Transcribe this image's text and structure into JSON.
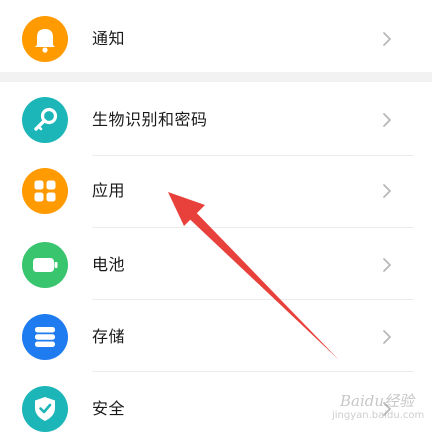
{
  "settings": {
    "items": [
      {
        "id": "notification",
        "label": "通知",
        "icon": "bell-icon",
        "color": "#FF9A00"
      },
      {
        "id": "biometrics",
        "label": "生物识别和密码",
        "icon": "key-icon",
        "color": "#1CB5B8"
      },
      {
        "id": "apps",
        "label": "应用",
        "icon": "grid-icon",
        "color": "#FF9A00"
      },
      {
        "id": "battery",
        "label": "电池",
        "icon": "battery-icon",
        "color": "#39C46E"
      },
      {
        "id": "storage",
        "label": "存储",
        "icon": "storage-icon",
        "color": "#1E7BF0"
      },
      {
        "id": "security",
        "label": "安全",
        "icon": "shield-icon",
        "color": "#1CB5B8"
      }
    ]
  },
  "annotation": {
    "color": "#E8403A"
  },
  "watermark": {
    "text": "Baidu经验",
    "sub": "jingyan.baidu.com"
  }
}
